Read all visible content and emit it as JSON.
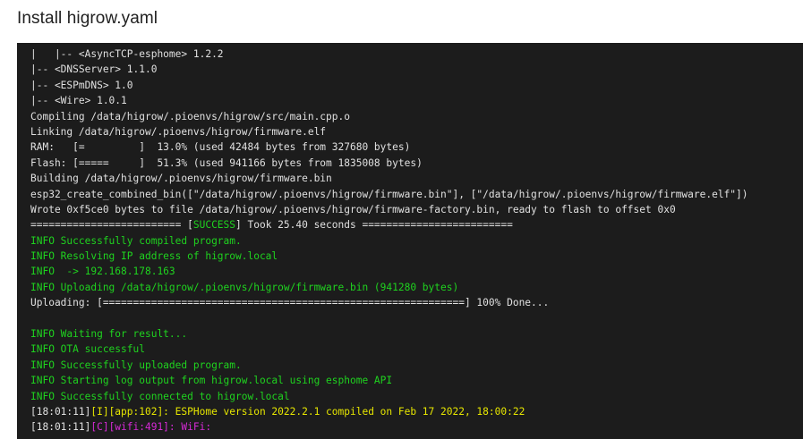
{
  "dialog": {
    "title": "Install higrow.yaml"
  },
  "colors": {
    "default": "#e0e0e0",
    "green": "#1fd31f",
    "yellow": "#e6e600",
    "magenta": "#d62ad6"
  },
  "log_lines": [
    [
      {
        "text": "|   |-- <AsyncTCP-esphome> 1.2.2",
        "color": "default"
      }
    ],
    [
      {
        "text": "|-- <DNSServer> 1.1.0",
        "color": "default"
      }
    ],
    [
      {
        "text": "|-- <ESPmDNS> 1.0",
        "color": "default"
      }
    ],
    [
      {
        "text": "|-- <Wire> 1.0.1",
        "color": "default"
      }
    ],
    [
      {
        "text": "Compiling /data/higrow/.pioenvs/higrow/src/main.cpp.o",
        "color": "default"
      }
    ],
    [
      {
        "text": "Linking /data/higrow/.pioenvs/higrow/firmware.elf",
        "color": "default"
      }
    ],
    [
      {
        "text": "RAM:   [=         ]  13.0% (used 42484 bytes from 327680 bytes)",
        "color": "default"
      }
    ],
    [
      {
        "text": "Flash: [=====     ]  51.3% (used 941166 bytes from 1835008 bytes)",
        "color": "default"
      }
    ],
    [
      {
        "text": "Building /data/higrow/.pioenvs/higrow/firmware.bin",
        "color": "default"
      }
    ],
    [
      {
        "text": "esp32_create_combined_bin([\"/data/higrow/.pioenvs/higrow/firmware.bin\"], [\"/data/higrow/.pioenvs/higrow/firmware.elf\"])",
        "color": "default"
      }
    ],
    [
      {
        "text": "Wrote 0xf5ce0 bytes to file /data/higrow/.pioenvs/higrow/firmware-factory.bin, ready to flash to offset 0x0",
        "color": "default"
      }
    ],
    [
      {
        "text": "========================= [",
        "color": "default"
      },
      {
        "text": "SUCCESS",
        "color": "green"
      },
      {
        "text": "] Took 25.40 seconds =========================",
        "color": "default"
      }
    ],
    [
      {
        "text": "INFO Successfully compiled program.",
        "color": "green"
      }
    ],
    [
      {
        "text": "INFO Resolving IP address of higrow.local",
        "color": "green"
      }
    ],
    [
      {
        "text": "INFO  -> 192.168.178.163",
        "color": "green"
      }
    ],
    [
      {
        "text": "INFO Uploading /data/higrow/.pioenvs/higrow/firmware.bin (941280 bytes)",
        "color": "green"
      }
    ],
    [
      {
        "text": "Uploading: [============================================================] 100% Done...",
        "color": "default"
      }
    ],
    [
      {
        "text": "",
        "color": "default"
      }
    ],
    [
      {
        "text": "INFO Waiting for result...",
        "color": "green"
      }
    ],
    [
      {
        "text": "INFO OTA successful",
        "color": "green"
      }
    ],
    [
      {
        "text": "INFO Successfully uploaded program.",
        "color": "green"
      }
    ],
    [
      {
        "text": "INFO Starting log output from higrow.local using esphome API",
        "color": "green"
      }
    ],
    [
      {
        "text": "INFO Successfully connected to higrow.local",
        "color": "green"
      }
    ],
    [
      {
        "text": "[18:01:11]",
        "color": "default"
      },
      {
        "text": "[I][app:102]: ESPHome version 2022.2.1 compiled on Feb 17 2022, 18:00:22",
        "color": "yellow"
      }
    ],
    [
      {
        "text": "[18:01:11]",
        "color": "default"
      },
      {
        "text": "[C][wifi:491]: WiFi:",
        "color": "magenta"
      }
    ]
  ]
}
